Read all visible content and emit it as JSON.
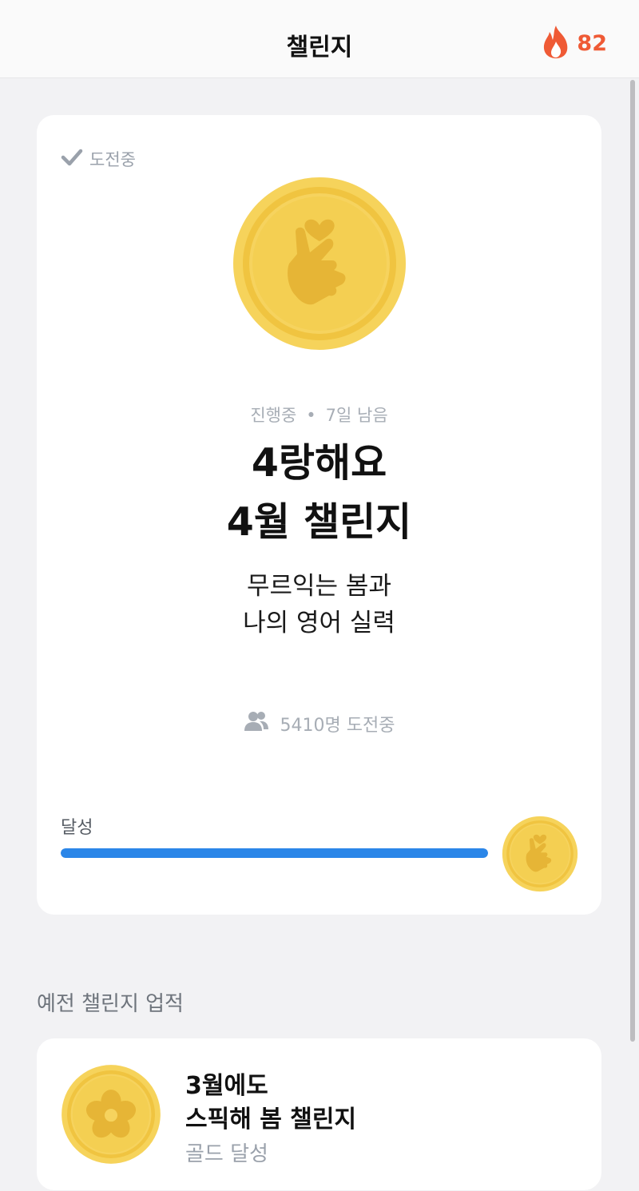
{
  "header": {
    "title": "챌린지",
    "streak_count": "82"
  },
  "current_challenge": {
    "status_label": "도전중",
    "progress_status": "진행중",
    "remaining": "7일 남음",
    "title_line1": "4랑해요",
    "title_line2": "4월 챌린지",
    "subtitle_line1": "무르익는 봄과",
    "subtitle_line2": "나의 영어 실력",
    "participants": "5410명 도전중",
    "progress_label": "달성",
    "progress_value": 1.0,
    "progress_color": "#2b86e8"
  },
  "past_section": {
    "title": "예전 챌린지 업적",
    "items": [
      {
        "title_line1": "3월에도",
        "title_line2": "스픽해 봄 챌린지",
        "result": "골드 달성"
      }
    ]
  },
  "icons": {
    "streak": "fire-icon",
    "status": "checkmark-icon",
    "participants": "people-icon",
    "medal_current": "finger-heart-gold-medal",
    "medal_past": "flower-gold-medal"
  },
  "colors": {
    "accent_orange": "#ef5a35",
    "gold": "#f2c84b"
  }
}
